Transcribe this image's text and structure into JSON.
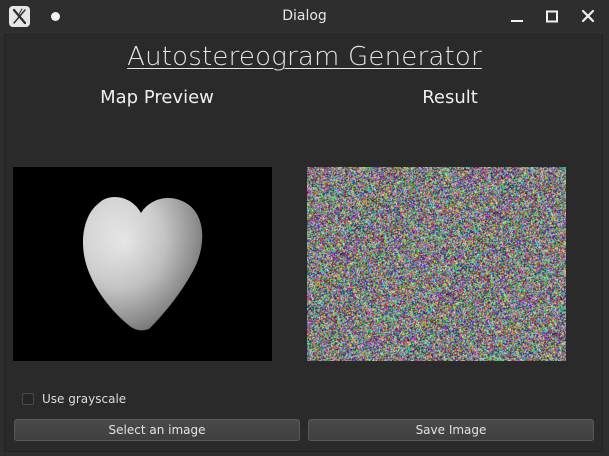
{
  "window": {
    "title": "Dialog",
    "icon": "app-x-icon",
    "controls": [
      "minimize-icon",
      "maximize-icon",
      "close-icon"
    ]
  },
  "main": {
    "heading": "Autostereogram Generator",
    "map_label": "Map Preview",
    "result_label": "Result",
    "map_image": "heart-depth-map",
    "result_image": "random-dot-stereogram"
  },
  "options": {
    "grayscale_label": "Use grayscale",
    "grayscale_checked": false
  },
  "buttons": {
    "select_label": "Select an image",
    "save_label": "Save Image"
  },
  "colors": {
    "window_bg": "#2e2e2e",
    "content_bg": "#2a2a2a",
    "button_bg": "#444444",
    "text": "#e4e4e4"
  }
}
